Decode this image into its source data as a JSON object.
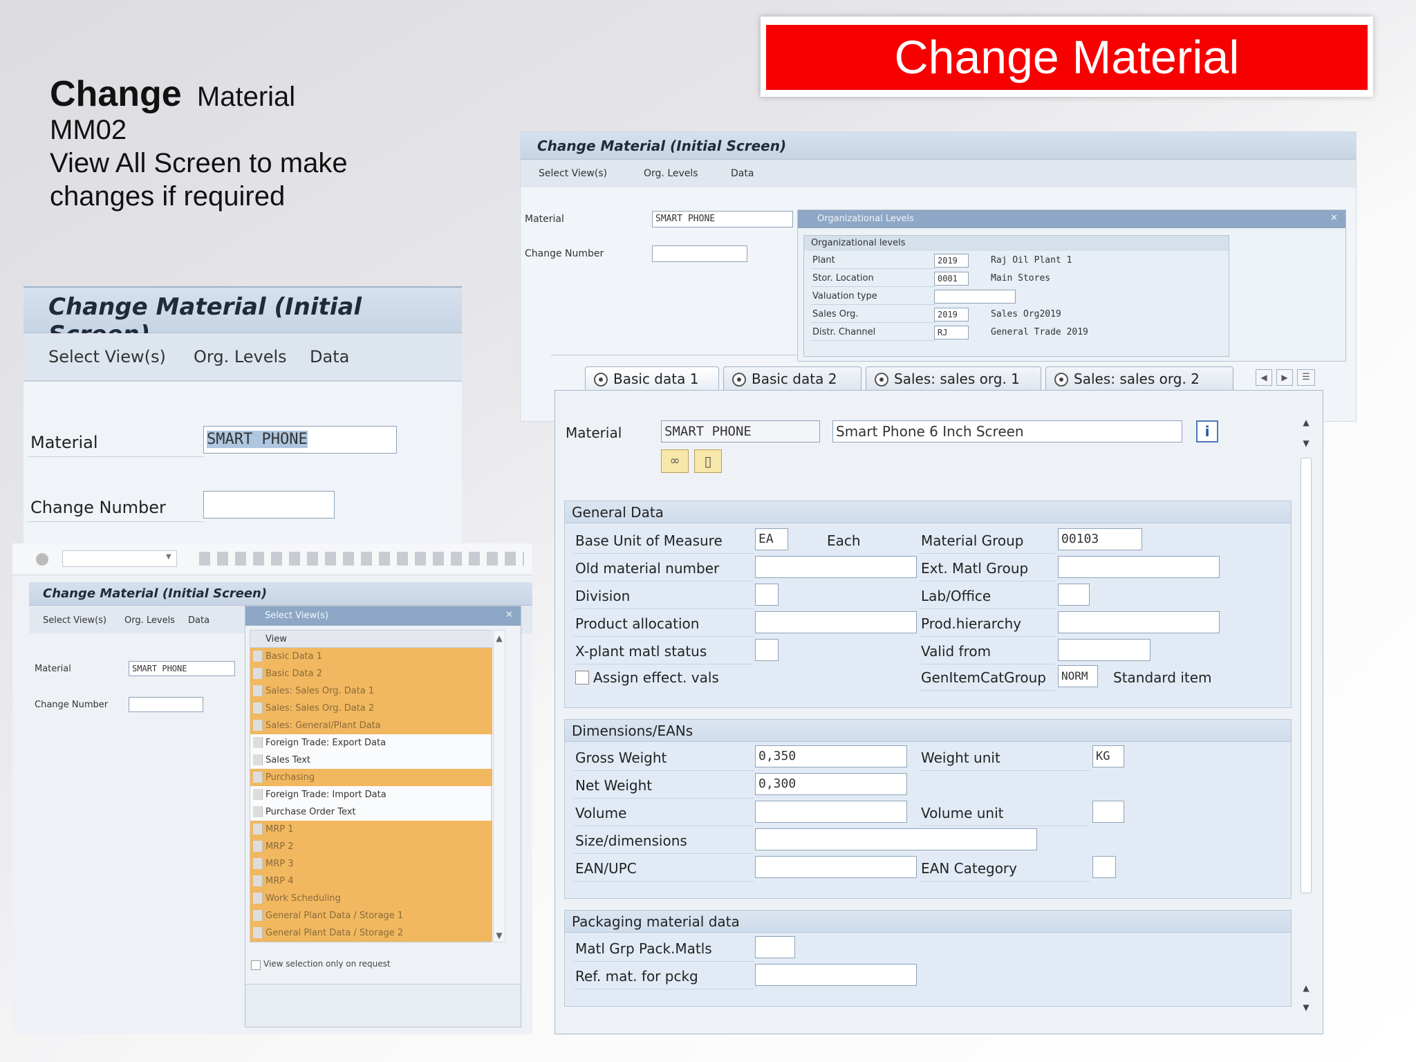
{
  "banner": {
    "title": "Change Material"
  },
  "intro": {
    "line1_bold": "Change",
    "line1_rest": "Material",
    "line2": "MM02",
    "line3": "View All Screen to make",
    "line4": "changes if required"
  },
  "screen_a": {
    "title": "Change Material (Initial Screen)",
    "menu": [
      "Select View(s)",
      "Org. Levels",
      "Data"
    ],
    "material_label": "Material",
    "material_value": "SMART PHONE",
    "change_number_label": "Change Number",
    "change_number_value": ""
  },
  "screen_b": {
    "title": "Change Material (Initial Screen)",
    "menu": [
      "Select View(s)",
      "Org. Levels",
      "Data"
    ],
    "material_label": "Material",
    "material_value": "SMART PHONE",
    "change_number_label": "Change Number",
    "dialog_title": "Select View(s)",
    "list_header": "View",
    "views": [
      {
        "label": "Basic Data 1",
        "selected": true
      },
      {
        "label": "Basic Data 2",
        "selected": true
      },
      {
        "label": "Sales: Sales Org. Data 1",
        "selected": true
      },
      {
        "label": "Sales: Sales Org. Data 2",
        "selected": true
      },
      {
        "label": "Sales: General/Plant Data",
        "selected": true
      },
      {
        "label": "Foreign Trade: Export Data",
        "selected": false
      },
      {
        "label": "Sales Text",
        "selected": false
      },
      {
        "label": "Purchasing",
        "selected": true
      },
      {
        "label": "Foreign Trade: Import Data",
        "selected": false
      },
      {
        "label": "Purchase Order Text",
        "selected": false
      },
      {
        "label": "MRP 1",
        "selected": true
      },
      {
        "label": "MRP 2",
        "selected": true
      },
      {
        "label": "MRP 3",
        "selected": true
      },
      {
        "label": "MRP 4",
        "selected": true
      },
      {
        "label": "Work Scheduling",
        "selected": true
      },
      {
        "label": "General Plant Data / Storage 1",
        "selected": true
      },
      {
        "label": "General Plant Data / Storage 2",
        "selected": true
      }
    ],
    "view_selection_label": "View selection only on request"
  },
  "screen_c": {
    "title": "Change Material (Initial Screen)",
    "menu": [
      "Select View(s)",
      "Org. Levels",
      "Data"
    ],
    "material_label": "Material",
    "material_value": "SMART PHONE",
    "change_number_label": "Change Number",
    "org_dialog_title": "Organizational Levels",
    "org_group_title": "Organizational levels",
    "org_rows": [
      {
        "label": "Plant",
        "value": "2019",
        "text": "Raj Oil Plant 1"
      },
      {
        "label": "Stor. Location",
        "value": "0001",
        "text": "Main Stores"
      },
      {
        "label": "Valuation type",
        "value": "",
        "text": ""
      },
      {
        "label": "Sales Org.",
        "value": "2019",
        "text": "Sales Org2019"
      },
      {
        "label": "Distr. Channel",
        "value": "RJ",
        "text": "General Trade 2019"
      }
    ]
  },
  "main": {
    "tabs": [
      "Basic data 1",
      "Basic data 2",
      "Sales: sales org. 1",
      "Sales: sales org. 2"
    ],
    "material_label": "Material",
    "material_value": "SMART PHONE",
    "material_desc": "Smart Phone 6 Inch Screen",
    "general": {
      "title": "General Data",
      "base_uom_label": "Base Unit of Measure",
      "base_uom": "EA",
      "base_uom_text": "Each",
      "mat_group_label": "Material Group",
      "mat_group": "00103",
      "old_mat_label": "Old material number",
      "ext_group_label": "Ext. Matl Group",
      "division_label": "Division",
      "lab_label": "Lab/Office",
      "prod_alloc_label": "Product allocation",
      "prod_hier_label": "Prod.hierarchy",
      "xplant_label": "X-plant matl status",
      "valid_from_label": "Valid from",
      "assign_label": "Assign effect. vals",
      "gen_item_label": "GenItemCatGroup",
      "gen_item": "NORM",
      "gen_item_text": "Standard item"
    },
    "dimensions": {
      "title": "Dimensions/EANs",
      "gross_label": "Gross Weight",
      "gross": "0,350",
      "weight_unit_label": "Weight unit",
      "weight_unit": "KG",
      "net_label": "Net Weight",
      "net": "0,300",
      "volume_label": "Volume",
      "volume_unit_label": "Volume unit",
      "size_label": "Size/dimensions",
      "ean_label": "EAN/UPC",
      "ean_cat_label": "EAN Category"
    },
    "packaging": {
      "title": "Packaging material data",
      "matl_grp_label": "Matl Grp Pack.Matls",
      "ref_label": "Ref. mat. for pckg"
    }
  }
}
